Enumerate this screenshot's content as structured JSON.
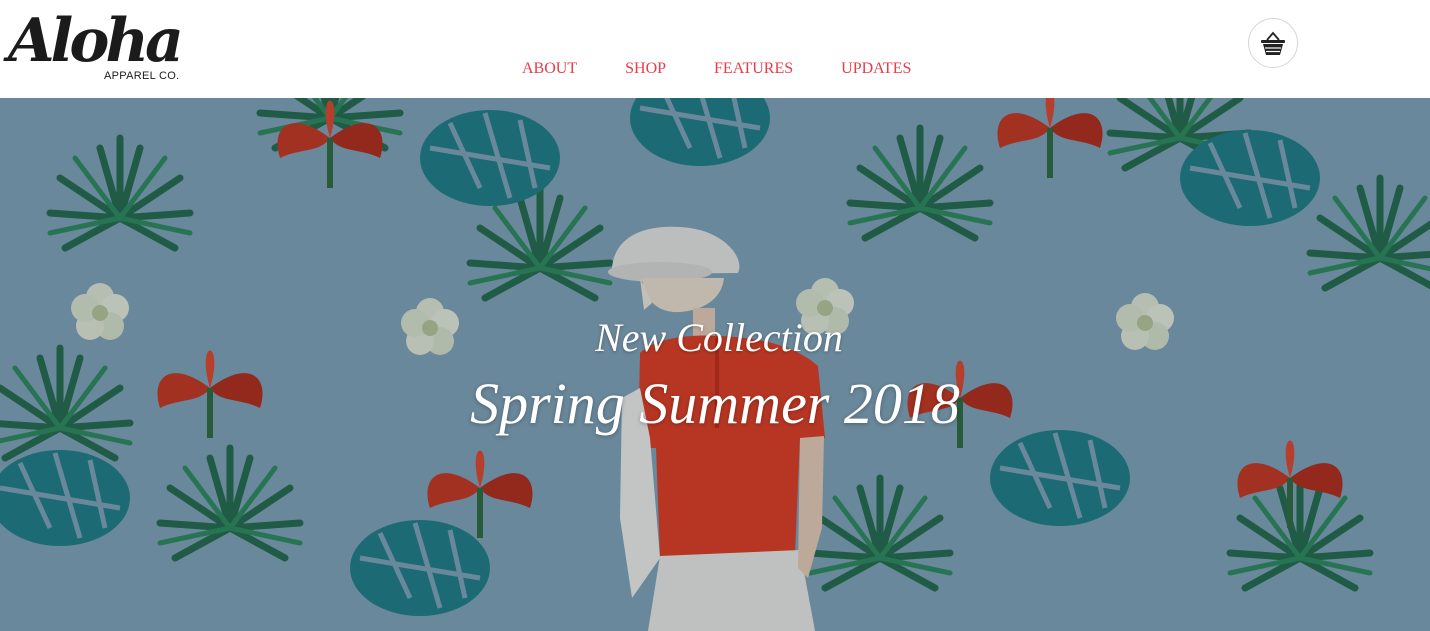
{
  "brand": {
    "logo_script": "Aloha",
    "logo_sub": "APPAREL CO."
  },
  "nav": {
    "items": [
      {
        "label": "ABOUT"
      },
      {
        "label": "SHOP"
      },
      {
        "label": "FEATURES"
      },
      {
        "label": "UPDATES"
      }
    ]
  },
  "cart": {
    "icon": "basket-icon"
  },
  "hero": {
    "kicker": "New Collection",
    "title": "Spring Summer 2018",
    "image": "tropical-print-model-photo"
  },
  "colors": {
    "nav_link": "#ea3b48",
    "hero_bg": "#7fa3b8",
    "text_dark": "#1b1b1b"
  }
}
